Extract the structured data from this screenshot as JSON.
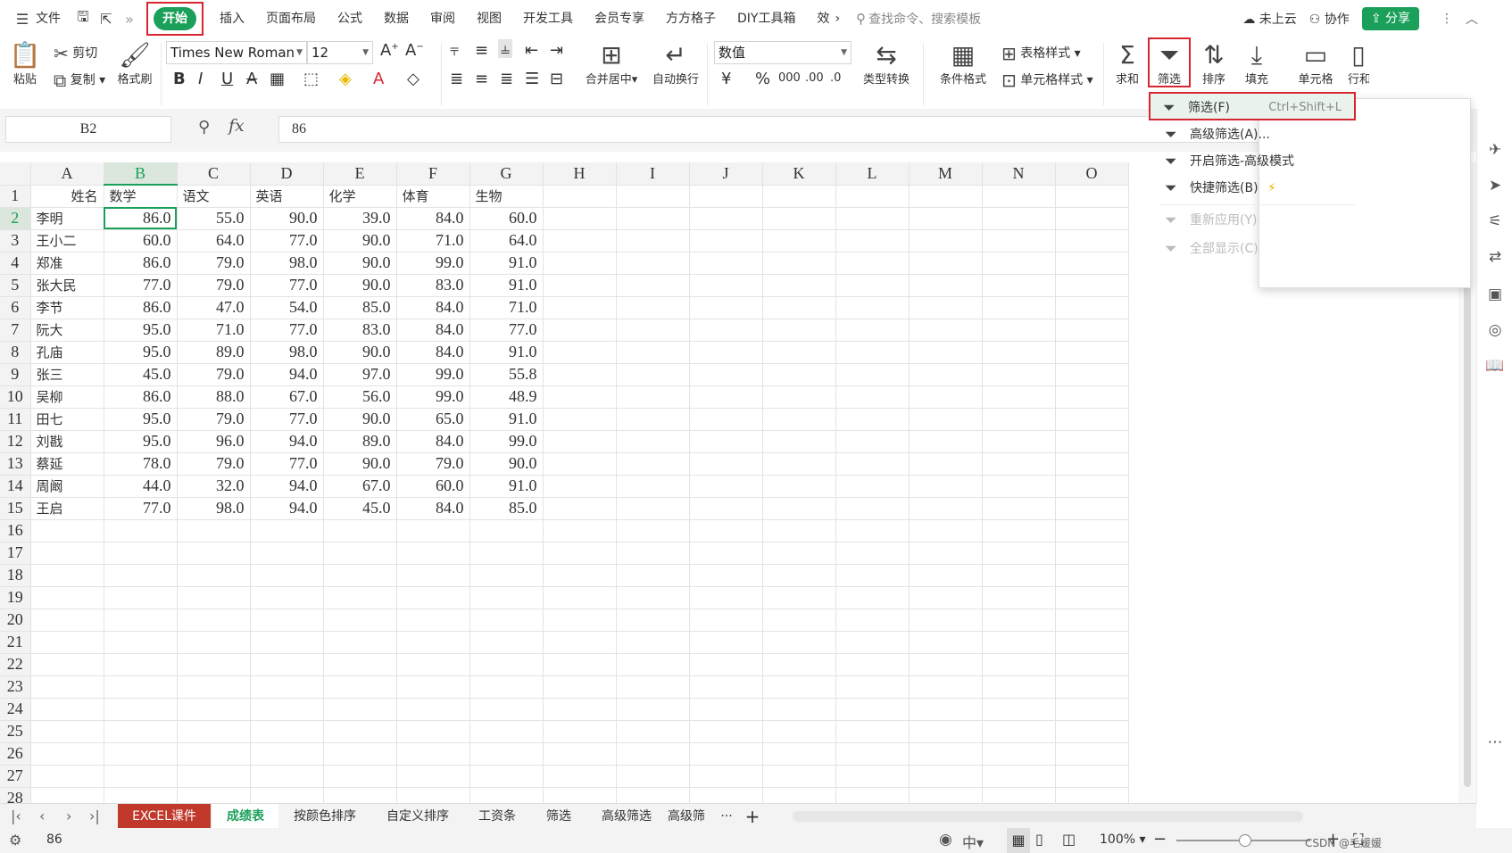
{
  "menubar": {
    "file_label": "文件",
    "tabs": [
      "开始",
      "插入",
      "页面布局",
      "公式",
      "数据",
      "审阅",
      "视图",
      "开发工具",
      "会员专享",
      "方方格子",
      "DIY工具箱",
      "效"
    ],
    "more": "›",
    "search_placeholder": "查找命令、搜索模板",
    "cloud_label": "未上云",
    "collab_label": "协作",
    "share_label": "分享"
  },
  "ribbon": {
    "paste": "粘贴",
    "cut": "剪切",
    "copy": "复制",
    "format_painter": "格式刷",
    "font_name": "Times New Roman",
    "font_size": "12",
    "merge_center": "合并居中",
    "wrap_text": "自动换行",
    "number_format": "数值",
    "type_convert": "类型转换",
    "cond_format": "条件格式",
    "table_style": "表格样式",
    "cell_style": "单元格样式",
    "sum": "求和",
    "filter": "筛选",
    "sort": "排序",
    "fill": "填充",
    "cell": "单元格",
    "rowcol": "行和"
  },
  "formula_bar": {
    "name_box": "B2",
    "fx": "fx",
    "value": "86"
  },
  "sheet": {
    "columns": [
      "A",
      "B",
      "C",
      "D",
      "E",
      "F",
      "G",
      "H",
      "I",
      "J",
      "K",
      "L",
      "M",
      "N",
      "O"
    ],
    "header": [
      "姓名",
      "数学",
      "语文",
      "英语",
      "化学",
      "体育",
      "生物"
    ],
    "rows": [
      [
        "李明",
        "86.0",
        "55.0",
        "90.0",
        "39.0",
        "84.0",
        "60.0"
      ],
      [
        "王小二",
        "60.0",
        "64.0",
        "77.0",
        "90.0",
        "71.0",
        "64.0"
      ],
      [
        "郑准",
        "86.0",
        "79.0",
        "98.0",
        "90.0",
        "99.0",
        "91.0"
      ],
      [
        "张大民",
        "77.0",
        "79.0",
        "77.0",
        "90.0",
        "83.0",
        "91.0"
      ],
      [
        "李节",
        "86.0",
        "47.0",
        "54.0",
        "85.0",
        "84.0",
        "71.0"
      ],
      [
        "阮大",
        "95.0",
        "71.0",
        "77.0",
        "83.0",
        "84.0",
        "77.0"
      ],
      [
        "孔庙",
        "95.0",
        "89.0",
        "98.0",
        "90.0",
        "84.0",
        "91.0"
      ],
      [
        "张三",
        "45.0",
        "79.0",
        "94.0",
        "97.0",
        "99.0",
        "55.8"
      ],
      [
        "吴柳",
        "86.0",
        "88.0",
        "67.0",
        "56.0",
        "99.0",
        "48.9"
      ],
      [
        "田七",
        "95.0",
        "79.0",
        "77.0",
        "90.0",
        "65.0",
        "91.0"
      ],
      [
        "刘戡",
        "95.0",
        "96.0",
        "94.0",
        "89.0",
        "84.0",
        "99.0"
      ],
      [
        "蔡延",
        "78.0",
        "79.0",
        "77.0",
        "90.0",
        "79.0",
        "90.0"
      ],
      [
        "周阚",
        "44.0",
        "32.0",
        "94.0",
        "67.0",
        "60.0",
        "91.0"
      ],
      [
        "王启",
        "77.0",
        "98.0",
        "94.0",
        "45.0",
        "84.0",
        "85.0"
      ]
    ],
    "total_visible_rows": 28
  },
  "dropdown": {
    "items": [
      {
        "label": "筛选(F)",
        "shortcut": "Ctrl+Shift+L",
        "disabled": false
      },
      {
        "label": "高级筛选(A)...",
        "shortcut": "",
        "disabled": false
      },
      {
        "label": "开启筛选-高级模式",
        "shortcut": "",
        "disabled": false
      },
      {
        "label": "快捷筛选(B)",
        "shortcut": "",
        "disabled": false
      },
      {
        "label": "重新应用(Y)",
        "shortcut": "",
        "disabled": true
      },
      {
        "label": "全部显示(C)",
        "shortcut": "",
        "disabled": true
      }
    ]
  },
  "tabs": {
    "sheets": [
      "EXCEL课件",
      "成绩表",
      "按颜色排序",
      "自定义排序",
      "工资条",
      "筛选",
      "高级筛选",
      "高级筛"
    ],
    "more": "···",
    "add": "+"
  },
  "status": {
    "value": "86",
    "zoom": "100%",
    "watermark": "CSDN @毛媛媛"
  },
  "colors": {
    "accent": "#1ba05a",
    "highlight_border": "#d8262f",
    "excel_tab": "#c0392b"
  }
}
